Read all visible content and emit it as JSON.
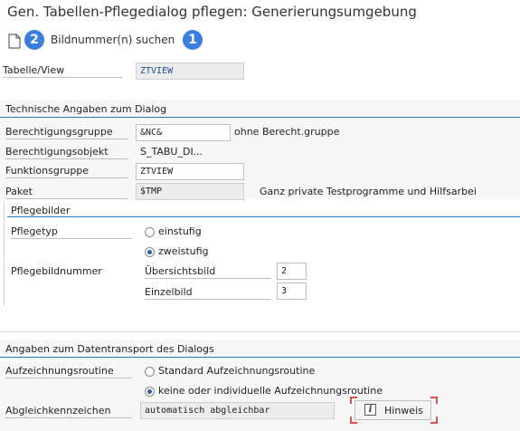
{
  "window": {
    "title": "Gen. Tabellen-Pflegedialog pflegen: Generierungsumgebung"
  },
  "toolbar": {
    "search_label": "Bildnummer(n) suchen",
    "badge_left": "2",
    "badge_right": "1"
  },
  "table_view": {
    "label": "Tabelle/View",
    "value": "ZTVIEW"
  },
  "technical": {
    "heading": "Technische Angaben zum Dialog",
    "auth_group_label": "Berechtigungsgruppe",
    "auth_group_value": "&NC&",
    "auth_group_desc": "ohne Berecht.gruppe",
    "auth_object_label": "Berechtigungsobjekt",
    "auth_object_value": "S_TABU_DI...",
    "function_group_label": "Funktionsgruppe",
    "function_group_value": "ZTVIEW",
    "package_label": "Paket",
    "package_value": "$TMP",
    "package_desc": "Ganz private Testprogramme und Hilfsarbei"
  },
  "maint_screens": {
    "heading": "Pflegebilder",
    "type_label": "Pflegetyp",
    "option_single": "einstufig",
    "option_two": "zweistufig",
    "selected": "zweistufig",
    "screen_number_label": "Pflegebildnummer",
    "overview_label": "Übersichtsbild",
    "overview_value": "2",
    "single_label": "Einzelbild",
    "single_value": "3"
  },
  "transport": {
    "heading": "Angaben zum Datentransport des Dialogs",
    "routine_label": "Aufzeichnungsroutine",
    "option_standard": "Standard Aufzeichnungsroutine",
    "option_none": "keine oder individuelle Aufzeichnungsroutine",
    "selected": "keine oder individuelle Aufzeichnungsroutine",
    "compare_label": "Abgleichkennzeichen",
    "compare_value": "automatisch abgleichbar",
    "hint_button": "Hinweis",
    "hint_icon": "info-icon"
  },
  "colors": {
    "accent_line": "#2b7bb9",
    "badge": "#3a7ee0",
    "hint_border": "#d9534f"
  }
}
